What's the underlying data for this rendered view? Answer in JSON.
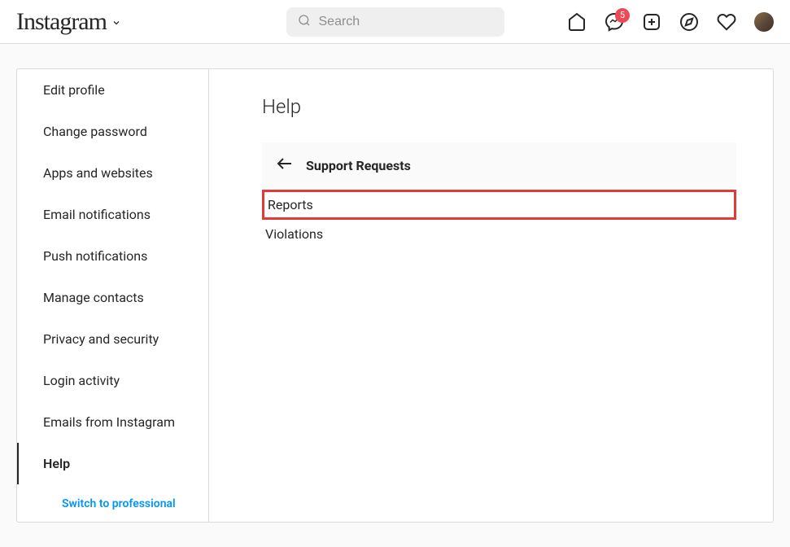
{
  "header": {
    "logo": "Instagram",
    "search_placeholder": "Search",
    "messenger_badge": "5"
  },
  "sidebar": {
    "items": [
      {
        "label": "Edit profile"
      },
      {
        "label": "Change password"
      },
      {
        "label": "Apps and websites"
      },
      {
        "label": "Email notifications"
      },
      {
        "label": "Push notifications"
      },
      {
        "label": "Manage contacts"
      },
      {
        "label": "Privacy and security"
      },
      {
        "label": "Login activity"
      },
      {
        "label": "Emails from Instagram"
      },
      {
        "label": "Help"
      }
    ],
    "switch_label": "Switch to professional"
  },
  "main": {
    "title": "Help",
    "support_header": "Support Requests",
    "support_items": [
      {
        "label": "Reports"
      },
      {
        "label": "Violations"
      }
    ]
  }
}
